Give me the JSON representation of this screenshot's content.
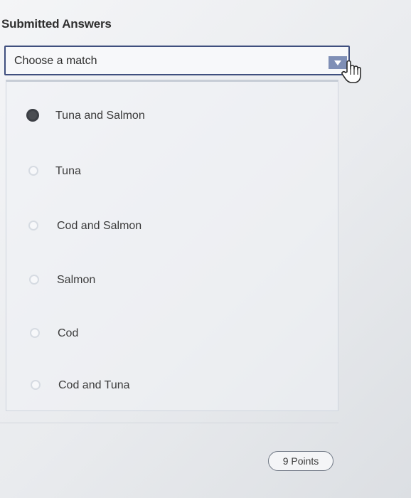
{
  "section": {
    "title": "Submitted Answers"
  },
  "select": {
    "value": "Choose a match",
    "arrow_icon": "caret-down-icon",
    "arrow_color": "#7f8fb6",
    "border_color": "#3f4f7e"
  },
  "options": [
    {
      "label": "Tuna and Salmon",
      "selected": true
    },
    {
      "label": "Tuna",
      "selected": false
    },
    {
      "label": "Cod and Salmon",
      "selected": false
    },
    {
      "label": "Salmon",
      "selected": false
    },
    {
      "label": "Cod",
      "selected": false
    },
    {
      "label": "Cod and Tuna",
      "selected": false
    }
  ],
  "points": {
    "label": "9 Points"
  }
}
